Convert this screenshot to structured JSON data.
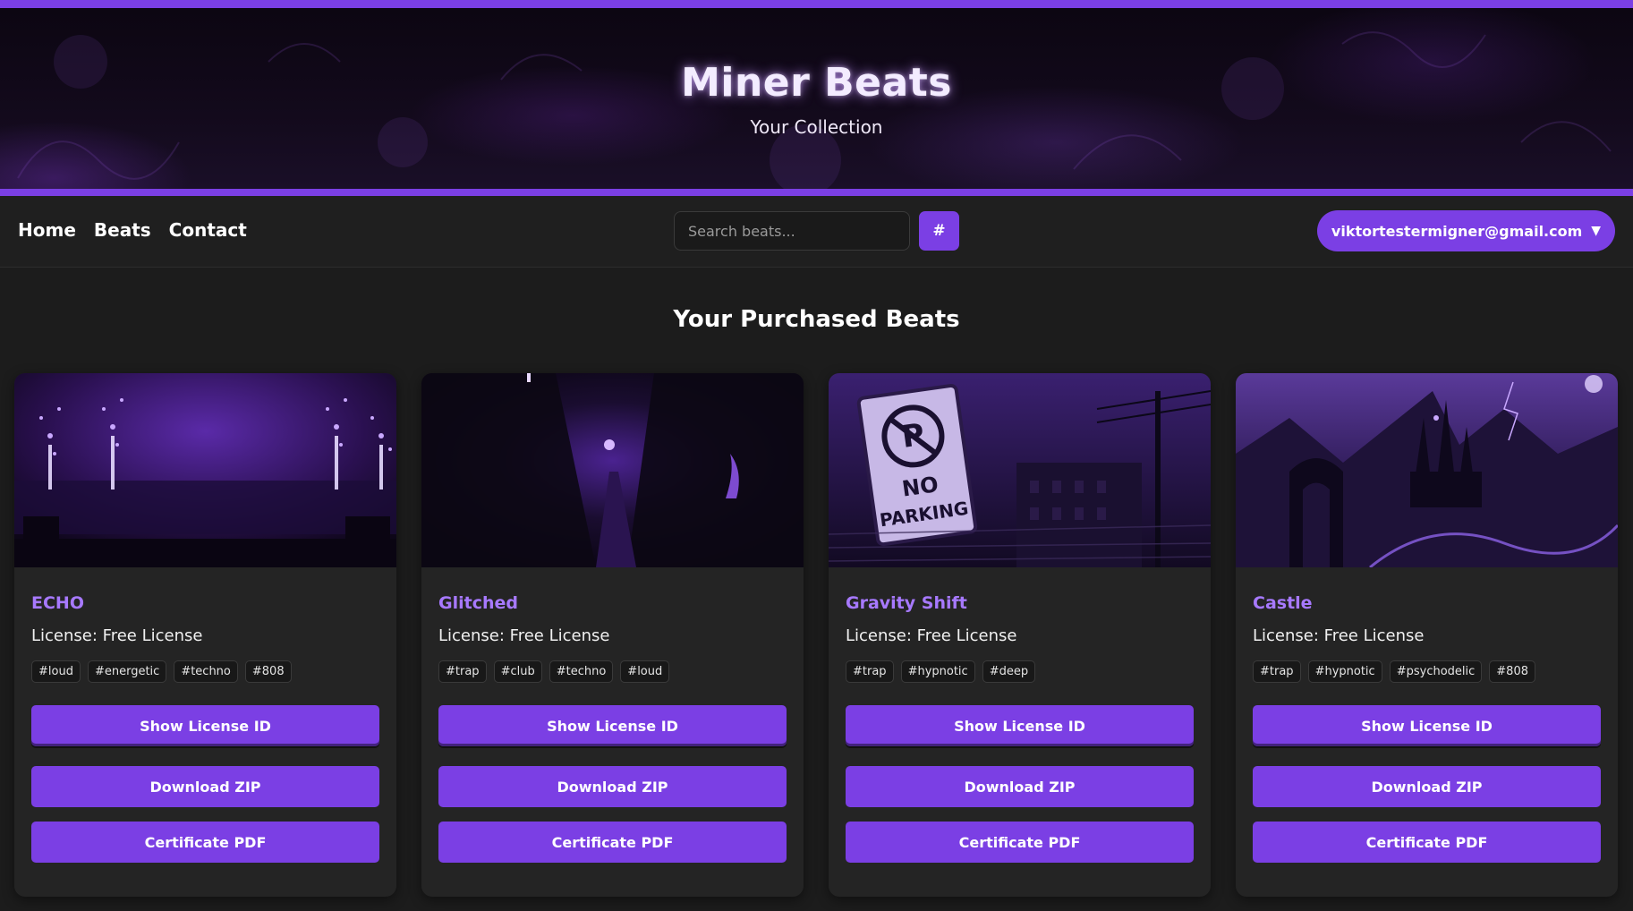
{
  "brand": {
    "title": "Miner Beats",
    "subtitle": "Your Collection",
    "accent": "#7b3fe4",
    "title_color": "#a779ff"
  },
  "nav": {
    "links": [
      "Home",
      "Beats",
      "Contact"
    ],
    "search_placeholder": "Search beats...",
    "hash_label": "#",
    "user_email": "viktortestermigner@gmail.com",
    "user_caret": "▼"
  },
  "main": {
    "heading": "Your Purchased Beats",
    "beats": [
      {
        "name": "ECHO",
        "license": "License: Free License",
        "tags": [
          "#loud",
          "#energetic",
          "#techno",
          "#808"
        ],
        "image": "concert-crowd-fireworks"
      },
      {
        "name": "Glitched",
        "license": "License: Free License",
        "tags": [
          "#trap",
          "#club",
          "#techno",
          "#loud"
        ],
        "image": "dark-alley"
      },
      {
        "name": "Gravity Shift",
        "license": "License: Free License",
        "tags": [
          "#trap",
          "#hypnotic",
          "#deep"
        ],
        "image": "no-parking-sign"
      },
      {
        "name": "Castle",
        "license": "License: Free License",
        "tags": [
          "#trap",
          "#hypnotic",
          "#psychodelic",
          "#808"
        ],
        "image": "dark-castle-mountains"
      }
    ],
    "buttons": {
      "license": "Show License ID",
      "zip": "Download ZIP",
      "pdf": "Certificate PDF"
    }
  }
}
